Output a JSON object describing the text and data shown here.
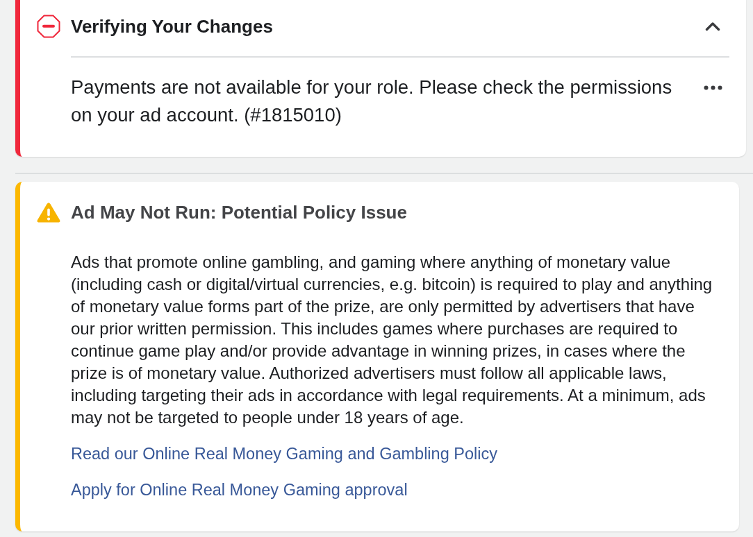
{
  "alerts": [
    {
      "kind": "error",
      "title": "Verifying Your Changes",
      "expanded": true,
      "message": "Payments are not available for your role. Please check the permissions on your ad account. (#1815010)"
    },
    {
      "kind": "warning",
      "title": "Ad May Not Run: Potential Policy Issue",
      "expanded": true,
      "message": "Ads that promote online gambling, and gaming where anything of monetary value (including cash or digital/virtual currencies, e.g. bitcoin) is required to play and anything of monetary value forms part of the prize, are only permitted by advertisers that have our prior written permission. This includes games where purchases are required to continue game play and/or provide advantage in winning prizes, in cases where the prize is of monetary value. Authorized advertisers must follow all applicable laws, including targeting their ads in accordance with legal requirements. At a minimum, ads may not be targeted to people under 18 years of age.",
      "links": [
        "Read our Online Real Money Gaming and Gambling Policy",
        "Apply for Online Real Money Gaming approval"
      ]
    }
  ]
}
